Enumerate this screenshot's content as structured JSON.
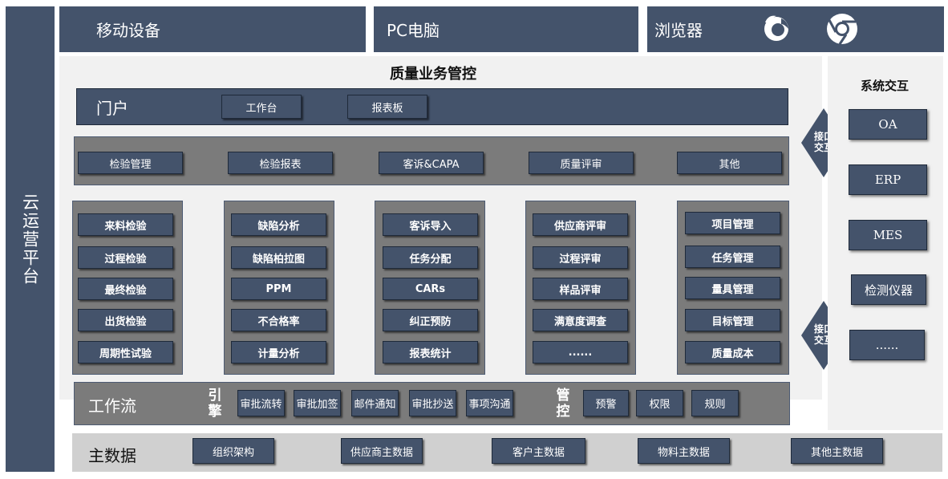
{
  "left_bar": {
    "label": "云运营平台"
  },
  "devices": {
    "mobile": "移动设备",
    "pc": "PC电脑",
    "browser": "浏览器"
  },
  "main": {
    "title": "质量业务管控",
    "portal": {
      "label": "门户",
      "tabs": [
        "工作台",
        "报表板"
      ]
    },
    "modules": [
      "检验管理",
      "检验报表",
      "客诉&CAPA",
      "质量评审",
      "其他"
    ],
    "columns": [
      [
        "来料检验",
        "过程检验",
        "最终检验",
        "出货检验",
        "周期性试验"
      ],
      [
        "缺陷分析",
        "缺陷柏拉图",
        "PPM",
        "不合格率",
        "计量分析"
      ],
      [
        "客诉导入",
        "任务分配",
        "CARs",
        "纠正预防",
        "报表统计"
      ],
      [
        "供应商评审",
        "过程评审",
        "样品评审",
        "满意度调查",
        "......"
      ],
      [
        "项目管理",
        "任务管理",
        "量具管理",
        "目标管理",
        "质量成本"
      ]
    ],
    "workflow": {
      "label": "工作流",
      "engine_label": "引擎",
      "engine_items": [
        "审批流转",
        "审批加签",
        "邮件通知",
        "审批抄送",
        "事项沟通"
      ],
      "control_label": "管控",
      "control_items": [
        "预警",
        "权限",
        "规则"
      ]
    },
    "master_data": {
      "label": "主数据",
      "items": [
        "组织架构",
        "供应商主数据",
        "客户主数据",
        "物料主数据",
        "其他主数据"
      ]
    }
  },
  "interface": {
    "arrow_label": "接口交互"
  },
  "system_interaction": {
    "title": "系统交互",
    "items": [
      "OA",
      "ERP",
      "MES",
      "检测仪器",
      "......"
    ]
  },
  "icons": [
    "firefox-icon",
    "chrome-icon"
  ],
  "colors": {
    "navy": "#44536b",
    "gray": "#7b7b7b",
    "light_panel": "#f1f1f1",
    "master_bg": "#d0d0d0"
  }
}
